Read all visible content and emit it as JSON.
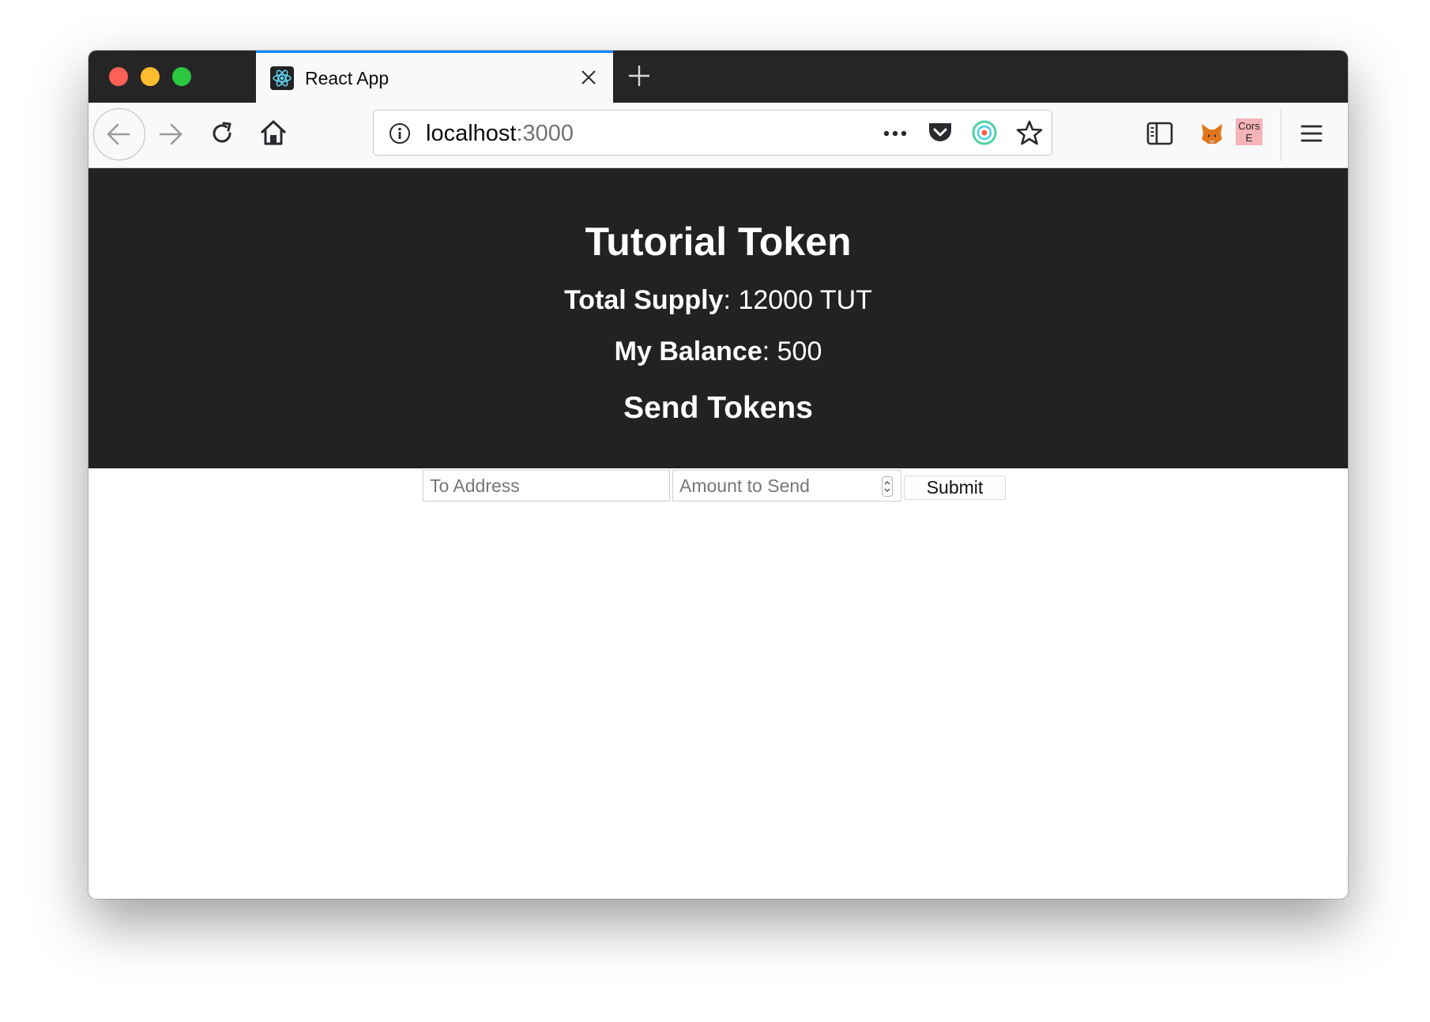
{
  "browser": {
    "tab": {
      "title": "React App"
    },
    "url": {
      "host": "localhost",
      "port": ":3000"
    },
    "extensions": {
      "cors_badge_line1": "Cors",
      "cors_badge_line2": "E"
    },
    "colors": {
      "tab_accent": "#0a84ff",
      "tabbar_bg": "#252526"
    }
  },
  "page": {
    "title": "Tutorial Token",
    "total_supply_label": "Total Supply",
    "total_supply_value": ": 12000 TUT",
    "balance_label": "My Balance",
    "balance_value": ": 500",
    "send_heading": "Send Tokens",
    "form": {
      "address_placeholder": "To Address",
      "amount_placeholder": "Amount to Send",
      "submit_label": "Submit"
    },
    "colors": {
      "header_bg": "#222222"
    }
  },
  "icons": [
    "react-favicon-icon",
    "close-tab-icon",
    "new-tab-icon",
    "back-arrow-icon",
    "forward-arrow-icon",
    "reload-icon",
    "home-icon",
    "site-info-icon",
    "page-actions-icon",
    "pocket-icon",
    "extension-ring-icon",
    "bookmark-star-icon",
    "sidebar-icon",
    "metamask-fox-icon",
    "hamburger-menu-icon"
  ]
}
